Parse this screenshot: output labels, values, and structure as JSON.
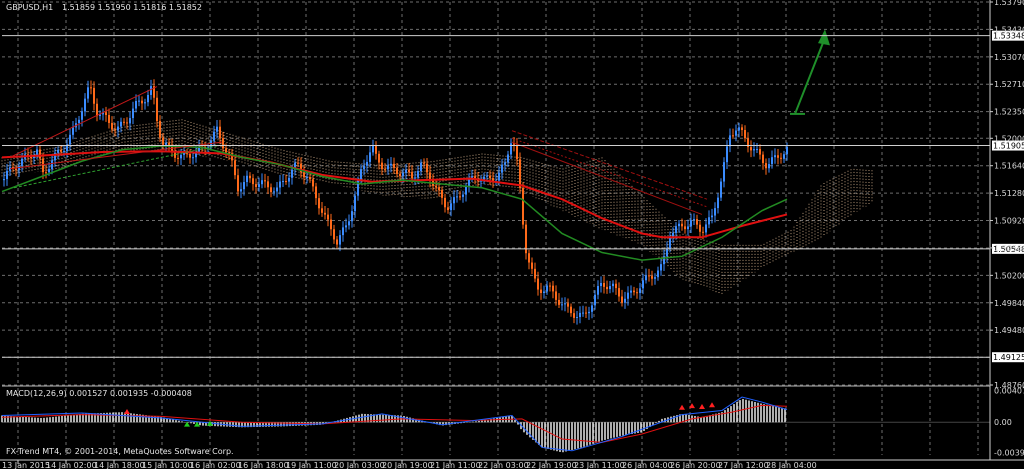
{
  "header": {
    "symbol": "GBPUSD,H1",
    "ohlc": "1.51859 1.51950 1.51816 1.51852"
  },
  "macd_header": "MACD(12,26,9) 0.001527 0.001935 -0.000408",
  "copyright": "FX-Trend MT4, © 2001-2014, MetaQuotes Software Corp.",
  "colors": {
    "background": "#000000",
    "grid": "#6e6e6e",
    "bull": "#3b8cff",
    "bear": "#ff6a1a",
    "ma_fast": "#228b22",
    "ma_slow": "#e01010",
    "cloud": "#f2c8a0",
    "macd_hist": "#e8e8e8",
    "macd_main": "#2060ff",
    "macd_signal": "#e01010",
    "arrow": "#1f8f2a"
  },
  "chart_data": [
    {
      "type": "candlestick",
      "title": "GBPUSD,H1",
      "price_ticks": [
        "1.53790",
        "1.53430",
        "1.53070",
        "1.52710",
        "1.52350",
        "1.52000",
        "1.51640",
        "1.51280",
        "1.50920",
        "1.50560",
        "1.50200",
        "1.49840",
        "1.49480",
        "1.49125",
        "1.48760"
      ],
      "tagged_levels": [
        {
          "label": "1.53348",
          "value": 1.53348
        },
        {
          "label": "1.51905",
          "value": 1.51905
        },
        {
          "label": "1.50548",
          "value": 1.50548
        },
        {
          "label": "1.49125",
          "value": 1.49125
        }
      ],
      "time_labels": [
        "13 Jan 2015",
        "14 Jan 02:00",
        "14 Jan 18:00",
        "15 Jan 10:00",
        "16 Jan 02:00",
        "16 Jan 18:00",
        "19 Jan 11:00",
        "20 Jan 03:00",
        "20 Jan 19:00",
        "21 Jan 11:00",
        "22 Jan 03:00",
        "22 Jan 19:00",
        "23 Jan 11:00",
        "26 Jan 04:00",
        "26 Jan 20:00",
        "27 Jan 12:00",
        "28 Jan 04:00"
      ],
      "price_path": [
        [
          0,
          1.5145
        ],
        [
          10,
          1.516
        ],
        [
          20,
          1.517
        ],
        [
          30,
          1.518
        ],
        [
          36,
          1.5185
        ],
        [
          40,
          1.515
        ],
        [
          50,
          1.5172
        ],
        [
          60,
          1.5185
        ],
        [
          70,
          1.5205
        ],
        [
          80,
          1.524
        ],
        [
          88,
          1.5268
        ],
        [
          95,
          1.5235
        ],
        [
          105,
          1.5225
        ],
        [
          115,
          1.521
        ],
        [
          125,
          1.5225
        ],
        [
          135,
          1.5245
        ],
        [
          145,
          1.5255
        ],
        [
          150,
          1.5265
        ],
        [
          155,
          1.5225
        ],
        [
          160,
          1.5195
        ],
        [
          170,
          1.5182
        ],
        [
          180,
          1.5175
        ],
        [
          190,
          1.518
        ],
        [
          200,
          1.5185
        ],
        [
          210,
          1.52
        ],
        [
          215,
          1.521
        ],
        [
          220,
          1.5195
        ],
        [
          228,
          1.5175
        ],
        [
          236,
          1.5135
        ],
        [
          245,
          1.5145
        ],
        [
          260,
          1.514
        ],
        [
          275,
          1.5132
        ],
        [
          285,
          1.515
        ],
        [
          295,
          1.5165
        ],
        [
          305,
          1.515
        ],
        [
          315,
          1.512
        ],
        [
          325,
          1.509
        ],
        [
          335,
          1.5065
        ],
        [
          345,
          1.5085
        ],
        [
          350,
          1.511
        ],
        [
          355,
          1.5135
        ],
        [
          360,
          1.516
        ],
        [
          365,
          1.5175
        ],
        [
          370,
          1.519
        ],
        [
          375,
          1.517
        ],
        [
          380,
          1.5165
        ],
        [
          390,
          1.516
        ],
        [
          400,
          1.5155
        ],
        [
          410,
          1.515
        ],
        [
          420,
          1.5165
        ],
        [
          428,
          1.515
        ],
        [
          435,
          1.513
        ],
        [
          445,
          1.511
        ],
        [
          455,
          1.512
        ],
        [
          465,
          1.514
        ],
        [
          475,
          1.515
        ],
        [
          485,
          1.5145
        ],
        [
          495,
          1.515
        ],
        [
          503,
          1.5165
        ],
        [
          510,
          1.5205
        ],
        [
          514,
          1.518
        ],
        [
          518,
          1.513
        ],
        [
          523,
          1.506
        ],
        [
          528,
          1.5035
        ],
        [
          535,
          1.5
        ],
        [
          545,
          1.5005
        ],
        [
          555,
          1.499
        ],
        [
          565,
          1.4975
        ],
        [
          575,
          1.4968
        ],
        [
          582,
          1.4965
        ],
        [
          590,
          1.4985
        ],
        [
          600,
          1.501
        ],
        [
          610,
          1.5005
        ],
        [
          620,
          1.499
        ],
        [
          630,
          1.4995
        ],
        [
          640,
          1.501
        ],
        [
          650,
          1.502
        ],
        [
          660,
          1.503
        ],
        [
          668,
          1.5075
        ],
        [
          680,
          1.5085
        ],
        [
          690,
          1.509
        ],
        [
          700,
          1.508
        ],
        [
          710,
          1.5095
        ],
        [
          720,
          1.515
        ],
        [
          728,
          1.5205
        ],
        [
          735,
          1.5215
        ],
        [
          745,
          1.5195
        ],
        [
          755,
          1.518
        ],
        [
          765,
          1.5165
        ],
        [
          775,
          1.5175
        ],
        [
          785,
          1.5185
        ]
      ],
      "ma_fast_path": [
        [
          0,
          1.513
        ],
        [
          40,
          1.515
        ],
        [
          80,
          1.517
        ],
        [
          120,
          1.5185
        ],
        [
          160,
          1.519
        ],
        [
          200,
          1.5188
        ],
        [
          240,
          1.5175
        ],
        [
          280,
          1.5165
        ],
        [
          320,
          1.515
        ],
        [
          360,
          1.514
        ],
        [
          400,
          1.5145
        ],
        [
          440,
          1.514
        ],
        [
          480,
          1.5135
        ],
        [
          520,
          1.512
        ],
        [
          560,
          1.5075
        ],
        [
          600,
          1.505
        ],
        [
          640,
          1.504
        ],
        [
          680,
          1.5045
        ],
        [
          720,
          1.507
        ],
        [
          760,
          1.5105
        ],
        [
          785,
          1.512
        ]
      ],
      "ma_slow_path": [
        [
          0,
          1.5175
        ],
        [
          50,
          1.5178
        ],
        [
          100,
          1.5182
        ],
        [
          160,
          1.5183
        ],
        [
          220,
          1.518
        ],
        [
          270,
          1.5168
        ],
        [
          320,
          1.5152
        ],
        [
          370,
          1.5143
        ],
        [
          420,
          1.5145
        ],
        [
          470,
          1.5147
        ],
        [
          520,
          1.5138
        ],
        [
          560,
          1.512
        ],
        [
          600,
          1.5095
        ],
        [
          640,
          1.5075
        ],
        [
          660,
          1.507
        ],
        [
          700,
          1.507
        ],
        [
          740,
          1.5085
        ],
        [
          785,
          1.51
        ]
      ],
      "cloud_bands": [
        [
          0,
          1.5175,
          1.515
        ],
        [
          60,
          1.519,
          1.516
        ],
        [
          120,
          1.5215,
          1.5185
        ],
        [
          180,
          1.5225,
          1.518
        ],
        [
          230,
          1.5205,
          1.517
        ],
        [
          280,
          1.5185,
          1.515
        ],
        [
          330,
          1.517,
          1.514
        ],
        [
          380,
          1.5165,
          1.5125
        ],
        [
          430,
          1.517,
          1.512
        ],
        [
          480,
          1.518,
          1.514
        ],
        [
          520,
          1.5175,
          1.513
        ],
        [
          560,
          1.516,
          1.5105
        ],
        [
          600,
          1.5175,
          1.508
        ],
        [
          640,
          1.5125,
          1.506
        ],
        [
          680,
          1.5075,
          1.5015
        ],
        [
          720,
          1.506,
          1.4995
        ],
        [
          760,
          1.506,
          1.503
        ],
        [
          790,
          1.508,
          1.505
        ],
        [
          820,
          1.514,
          1.507
        ],
        [
          850,
          1.516,
          1.51
        ],
        [
          870,
          1.5158,
          1.5115
        ]
      ],
      "annotation": "up arrow (green)"
    },
    {
      "type": "bar",
      "title": "MACD(12,26,9)",
      "y_ticks": [
        "0.004074",
        "0.00",
        "-0.00390"
      ],
      "histogram": [
        [
          0,
          0.0008
        ],
        [
          40,
          0.0005
        ],
        [
          80,
          0.001
        ],
        [
          120,
          0.0012
        ],
        [
          160,
          0.0006
        ],
        [
          200,
          -0.0004
        ],
        [
          240,
          -0.0006
        ],
        [
          280,
          -0.0005
        ],
        [
          320,
          -0.0003
        ],
        [
          360,
          0.001
        ],
        [
          400,
          0.0008
        ],
        [
          440,
          -0.0004
        ],
        [
          480,
          0.0002
        ],
        [
          510,
          0.0008
        ],
        [
          520,
          -0.001
        ],
        [
          540,
          -0.003
        ],
        [
          560,
          -0.0036
        ],
        [
          580,
          -0.003
        ],
        [
          600,
          -0.0022
        ],
        [
          620,
          -0.0016
        ],
        [
          640,
          -0.0012
        ],
        [
          660,
          0.0004
        ],
        [
          680,
          0.001
        ],
        [
          700,
          0.0006
        ],
        [
          720,
          0.0012
        ],
        [
          740,
          0.0028
        ],
        [
          760,
          0.0022
        ],
        [
          785,
          0.0016
        ]
      ],
      "main_line": [
        [
          0,
          0.0008
        ],
        [
          80,
          0.0011
        ],
        [
          160,
          0.0005
        ],
        [
          240,
          -0.0005
        ],
        [
          320,
          -0.0002
        ],
        [
          380,
          0.001
        ],
        [
          440,
          -0.0003
        ],
        [
          510,
          0.0008
        ],
        [
          540,
          -0.003
        ],
        [
          570,
          -0.0034
        ],
        [
          620,
          -0.0017
        ],
        [
          680,
          0.0009
        ],
        [
          720,
          0.0014
        ],
        [
          740,
          0.003
        ],
        [
          760,
          0.0024
        ],
        [
          785,
          0.0015
        ]
      ],
      "signal_line": [
        [
          0,
          0.0006
        ],
        [
          80,
          0.0009
        ],
        [
          160,
          0.0007
        ],
        [
          240,
          0.0
        ],
        [
          320,
          -0.0002
        ],
        [
          400,
          0.0004
        ],
        [
          470,
          0.0002
        ],
        [
          520,
          0.0004
        ],
        [
          560,
          -0.002
        ],
        [
          600,
          -0.0024
        ],
        [
          640,
          -0.0014
        ],
        [
          690,
          0.0004
        ],
        [
          730,
          0.0012
        ],
        [
          760,
          0.002
        ],
        [
          785,
          0.0019
        ]
      ]
    }
  ]
}
